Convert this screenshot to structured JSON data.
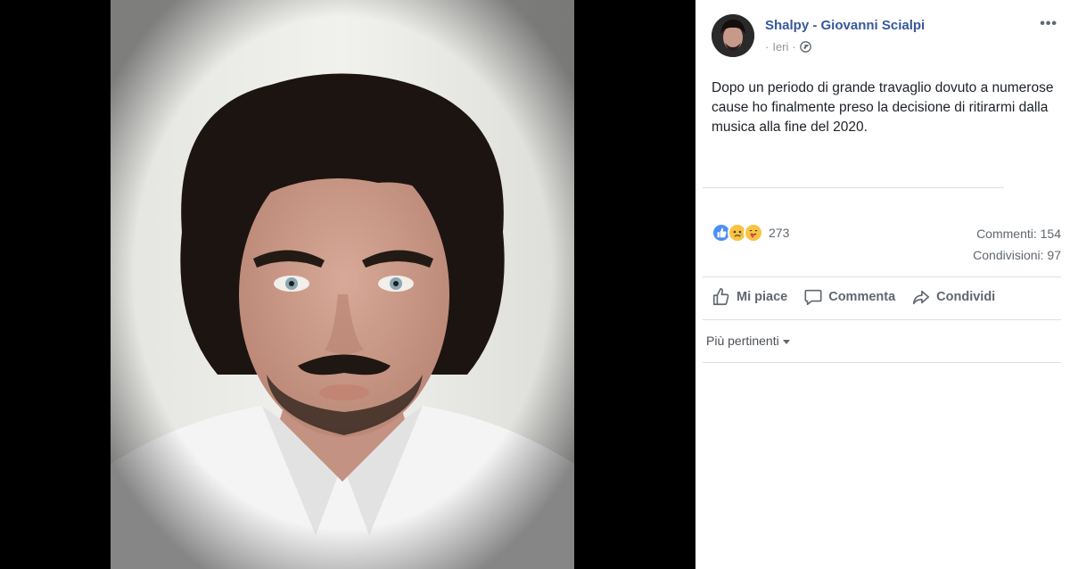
{
  "post": {
    "author": "Shalpy - Giovanni Scialpi",
    "time": "Ieri",
    "separator": "·",
    "text": "Dopo un periodo di grande travaglio dovuto a numerose cause ho finalmente preso la decisione di ritirarmi dalla musica alla fine del 2020.",
    "privacy_icon": "globe-icon",
    "options_icon": "more-options-icon",
    "options_glyph": "•••"
  },
  "stats": {
    "reactions_count": "273",
    "reaction_icons": [
      "like-reaction-icon",
      "sad-reaction-icon",
      "care-reaction-icon"
    ],
    "comments": "Commenti: 154",
    "shares": "Condivisioni: 97"
  },
  "actions": {
    "like": "Mi piace",
    "comment": "Commenta",
    "share": "Condividi"
  },
  "comments": {
    "sort_label": "Più pertinenti"
  },
  "colors": {
    "author_link": "#365899",
    "secondary_text": "#90949c",
    "like_blue": "#4d8ef7",
    "reaction_yellow": "#f7c443"
  }
}
